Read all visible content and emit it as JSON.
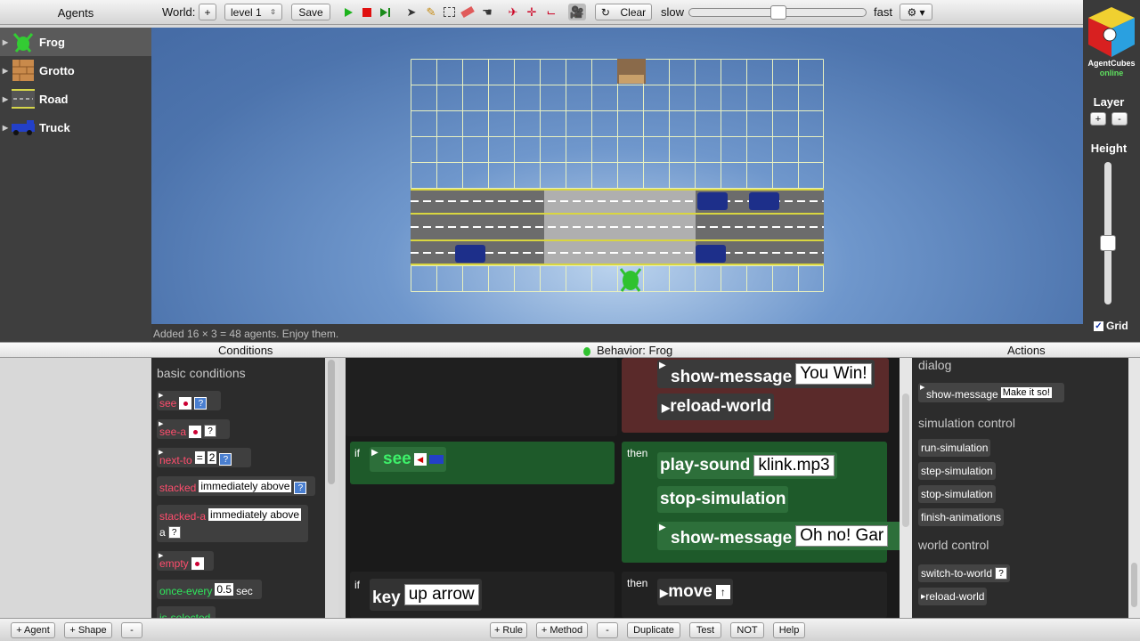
{
  "toolbar": {
    "agents_title": "Agents",
    "world_label": "World:",
    "add_world": "+",
    "level_select": "level 1",
    "save": "Save",
    "clear": "Clear",
    "slow": "slow",
    "fast": "fast",
    "speed_level": 0.5
  },
  "agents": [
    {
      "name": "Frog",
      "icon": "frog-icon",
      "selected": true
    },
    {
      "name": "Grotto",
      "icon": "grotto-icon",
      "selected": false
    },
    {
      "name": "Road",
      "icon": "road-icon",
      "selected": false
    },
    {
      "name": "Truck",
      "icon": "truck-icon",
      "selected": false
    }
  ],
  "status": "Added 16 × 3 = 48 agents. Enjoy them.",
  "right_panel": {
    "brand": "AgentCubes",
    "brand_sub": "online",
    "layer": "Layer",
    "layer_plus": "+",
    "layer_minus": "-",
    "height": "Height",
    "grid": "Grid",
    "grid_checked": true
  },
  "headers": {
    "conditions": "Conditions",
    "behavior": "Behavior: Frog",
    "actions": "Actions"
  },
  "conditions": {
    "section": "basic conditions",
    "items": {
      "see": "see",
      "see_a": "see-a",
      "next_to": "next-to",
      "next_to_op": "=",
      "next_to_val": "2",
      "stacked": "stacked",
      "stacked_val": "immediately above",
      "stacked_a": "stacked-a",
      "stacked_a_val": "immediately above",
      "stacked_a_suffix": "a",
      "empty": "empty",
      "once_every": "once-every",
      "once_every_val": "0.5",
      "once_every_unit": "sec",
      "is_selected": "is-selected",
      "qmark": "?"
    }
  },
  "behavior": {
    "rule1": {
      "action1": "show-message",
      "action1_val": "You Win!",
      "action2": "reload-world"
    },
    "rule2": {
      "if": "if",
      "condition": "see",
      "then": "then",
      "action1": "play-sound",
      "action1_val": "klink.mp3",
      "action2": "stop-simulation",
      "action3": "show-message",
      "action3_val": "Oh no! Gar"
    },
    "rule3": {
      "if": "if",
      "condition": "key",
      "condition_val": "up arrow",
      "then": "then",
      "action1": "move"
    }
  },
  "actions": {
    "dialog": "dialog",
    "show_message": "show-message",
    "show_message_val": "Make it so!",
    "simulation_control": "simulation control",
    "run": "run-simulation",
    "step": "step-simulation",
    "stop": "stop-simulation",
    "finish": "finish-animations",
    "world_control": "world control",
    "switch": "switch-to-world",
    "switch_q": "?",
    "reload": "reload-world"
  },
  "bottombar": {
    "add_agent": "+ Agent",
    "add_shape": "+ Shape",
    "minus": "-",
    "add_rule": "+ Rule",
    "add_method": "+ Method",
    "minus2": "-",
    "duplicate": "Duplicate",
    "test": "Test",
    "not": "NOT",
    "help": "Help"
  }
}
